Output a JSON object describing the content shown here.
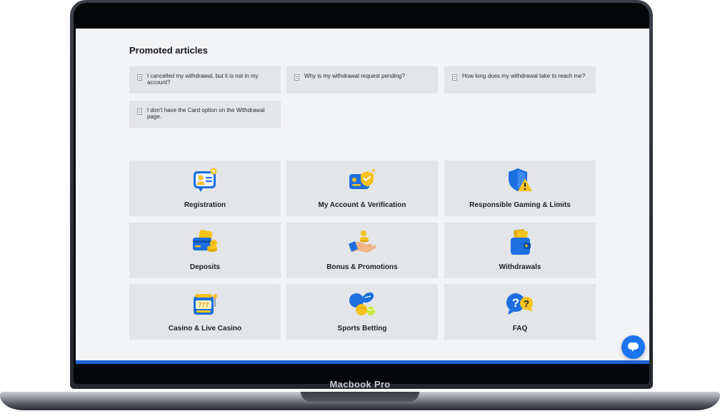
{
  "device": {
    "label": "Macbook Pro"
  },
  "promoted": {
    "heading": "Promoted articles",
    "articles": [
      {
        "label": "I cancelled my withdrawal, but it is not in my account?",
        "icon": "document-icon"
      },
      {
        "label": "Why is my withdrawal request pending?",
        "icon": "document-icon"
      },
      {
        "label": "How long does my withdrawal take to reach me?",
        "icon": "document-icon"
      },
      {
        "label": "I don't have the Card option on the Withdrawal page.",
        "icon": "document-icon"
      }
    ]
  },
  "categories": [
    {
      "label": "Registration",
      "icon": "registration-id-card-icon"
    },
    {
      "label": "My Account & Verification",
      "icon": "verified-card-shield-icon"
    },
    {
      "label": "Responsible Gaming & Limits",
      "icon": "shield-warning-icon"
    },
    {
      "label": "Deposits",
      "icon": "card-coins-icon"
    },
    {
      "label": "Bonus & Promotions",
      "icon": "hand-coins-icon"
    },
    {
      "label": "Withdrawals",
      "icon": "wallet-icon"
    },
    {
      "label": "Casino & Live Casino",
      "icon": "slot-machine-icon"
    },
    {
      "label": "Sports Betting",
      "icon": "sports-balls-icon"
    },
    {
      "label": "FAQ",
      "icon": "question-bubbles-icon"
    }
  ],
  "chat": {
    "icon": "chat-bubble-icon"
  },
  "colors": {
    "accent_blue": "#1b74f0",
    "bottom_bar": "#1f5fd6",
    "tile_bg": "#e3e5e8",
    "page_bg": "#f3f4f6",
    "icon_yellow": "#f6c21c"
  }
}
